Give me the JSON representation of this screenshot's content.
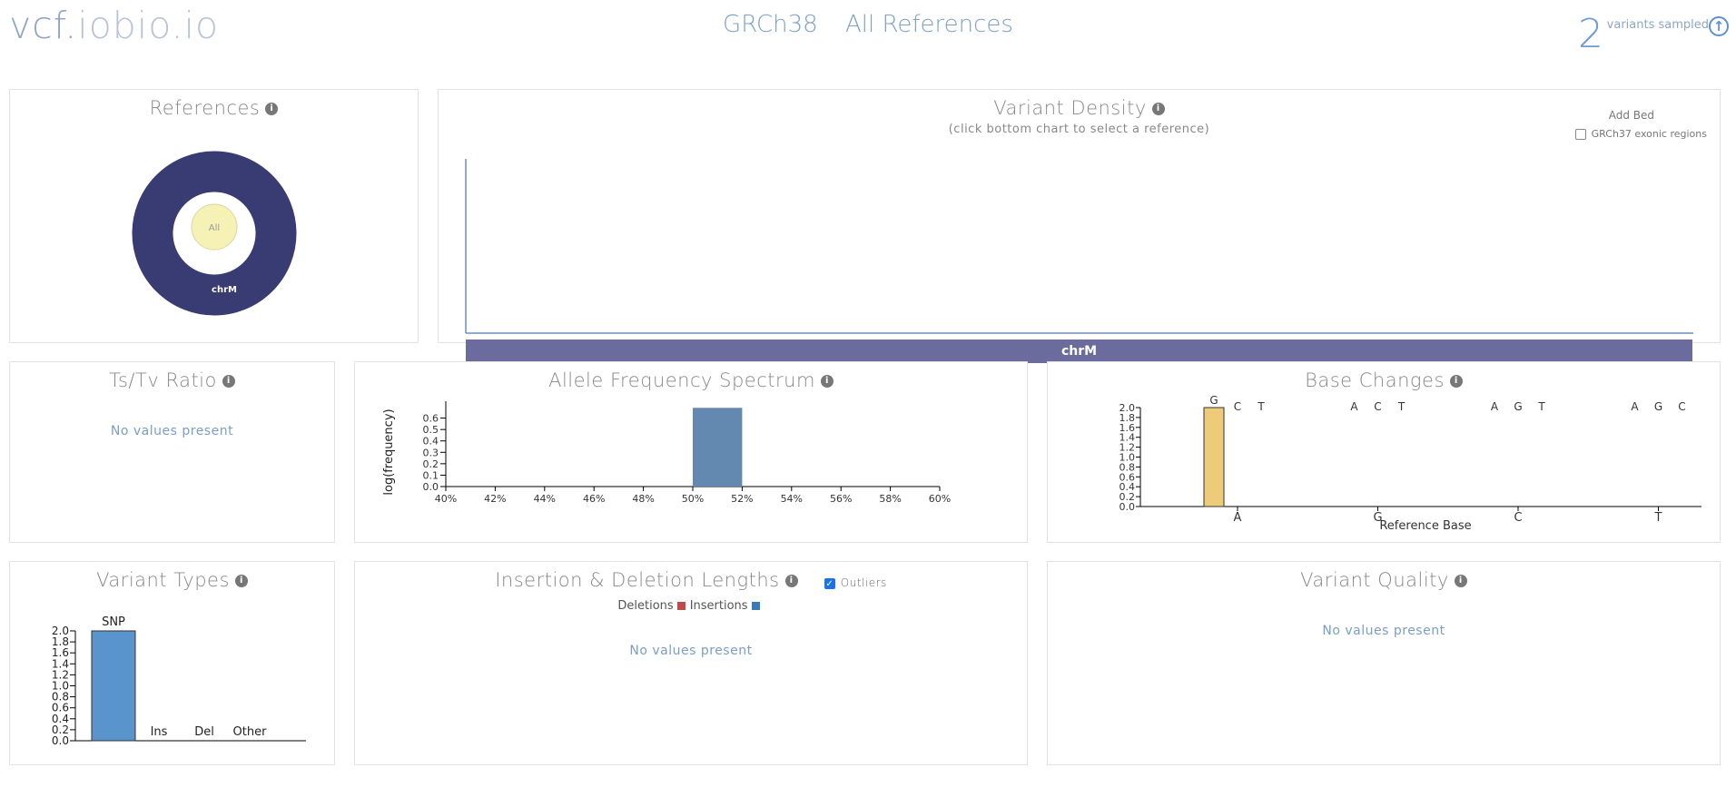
{
  "header": {
    "brand_main": "vcf.",
    "brand_rest": "iobio.io",
    "build": "GRCh38",
    "reference_label": "All References",
    "sampled_count": "2",
    "sampled_label": "variants sampled"
  },
  "references_panel": {
    "title": "References",
    "center_label": "All",
    "segment_label": "chrM"
  },
  "density_panel": {
    "title": "Variant Density",
    "subtitle": "(click bottom chart to select a reference)",
    "add_bed_label": "Add Bed",
    "exonic_label": "GRCh37 exonic regions",
    "bottom_bar_label": "chrM"
  },
  "tstv_panel": {
    "title": "Ts/Tv Ratio",
    "empty_text": "No values present"
  },
  "afs_panel": {
    "title": "Allele Frequency Spectrum"
  },
  "base_changes_panel": {
    "title": "Base Changes"
  },
  "variant_types_panel": {
    "title": "Variant Types"
  },
  "indel_panel": {
    "title": "Insertion & Deletion Lengths",
    "outliers_label": "Outliers",
    "deletions_label": "Deletions",
    "insertions_label": "Insertions",
    "empty_text": "No values present"
  },
  "quality_panel": {
    "title": "Variant Quality",
    "empty_text": "No values present"
  },
  "colors": {
    "donut": "#393b73",
    "center_circle": "#f6f2b5",
    "bottom_bar": "#6b6b9d",
    "afs_bar": "#6489b0",
    "base_bar": "#eecb79",
    "types_bar": "#5a94cc",
    "deletions": "#c04a4a",
    "insertions": "#3a79b5"
  },
  "chart_data": [
    {
      "id": "afs",
      "type": "bar",
      "ylabel": "log(frequency)",
      "x_ticks": [
        "40%",
        "42%",
        "44%",
        "46%",
        "48%",
        "50%",
        "52%",
        "54%",
        "56%",
        "58%",
        "60%"
      ],
      "y_ticks": [
        "0.0",
        "0.1",
        "0.2",
        "0.3",
        "0.4",
        "0.5",
        "0.6"
      ],
      "bars": [
        {
          "x_start": 50,
          "x_end": 52,
          "value": 0.69
        }
      ],
      "ylim": [
        0,
        0.7
      ]
    },
    {
      "id": "base_changes",
      "type": "bar",
      "xlabel": "Reference Base",
      "categories": [
        "A",
        "G",
        "C",
        "T"
      ],
      "alt_labels": [
        "G C T",
        "A C T",
        "A G T",
        "A G C"
      ],
      "values": [
        [
          2,
          0,
          0
        ],
        [
          0,
          0,
          0
        ],
        [
          0,
          0,
          0
        ],
        [
          0,
          0,
          0
        ]
      ],
      "y_ticks": [
        "0.0",
        "0.2",
        "0.4",
        "0.6",
        "0.8",
        "1.0",
        "1.2",
        "1.4",
        "1.6",
        "1.8",
        "2.0"
      ],
      "ylim": [
        0,
        2
      ]
    },
    {
      "id": "variant_types",
      "type": "bar",
      "categories": [
        "SNP",
        "Ins",
        "Del",
        "Other"
      ],
      "values": [
        2,
        0,
        0,
        0
      ],
      "y_ticks": [
        "0.0",
        "0.2",
        "0.4",
        "0.6",
        "0.8",
        "1.0",
        "1.2",
        "1.4",
        "1.6",
        "1.8",
        "2.0"
      ],
      "ylim": [
        0,
        2
      ]
    }
  ]
}
